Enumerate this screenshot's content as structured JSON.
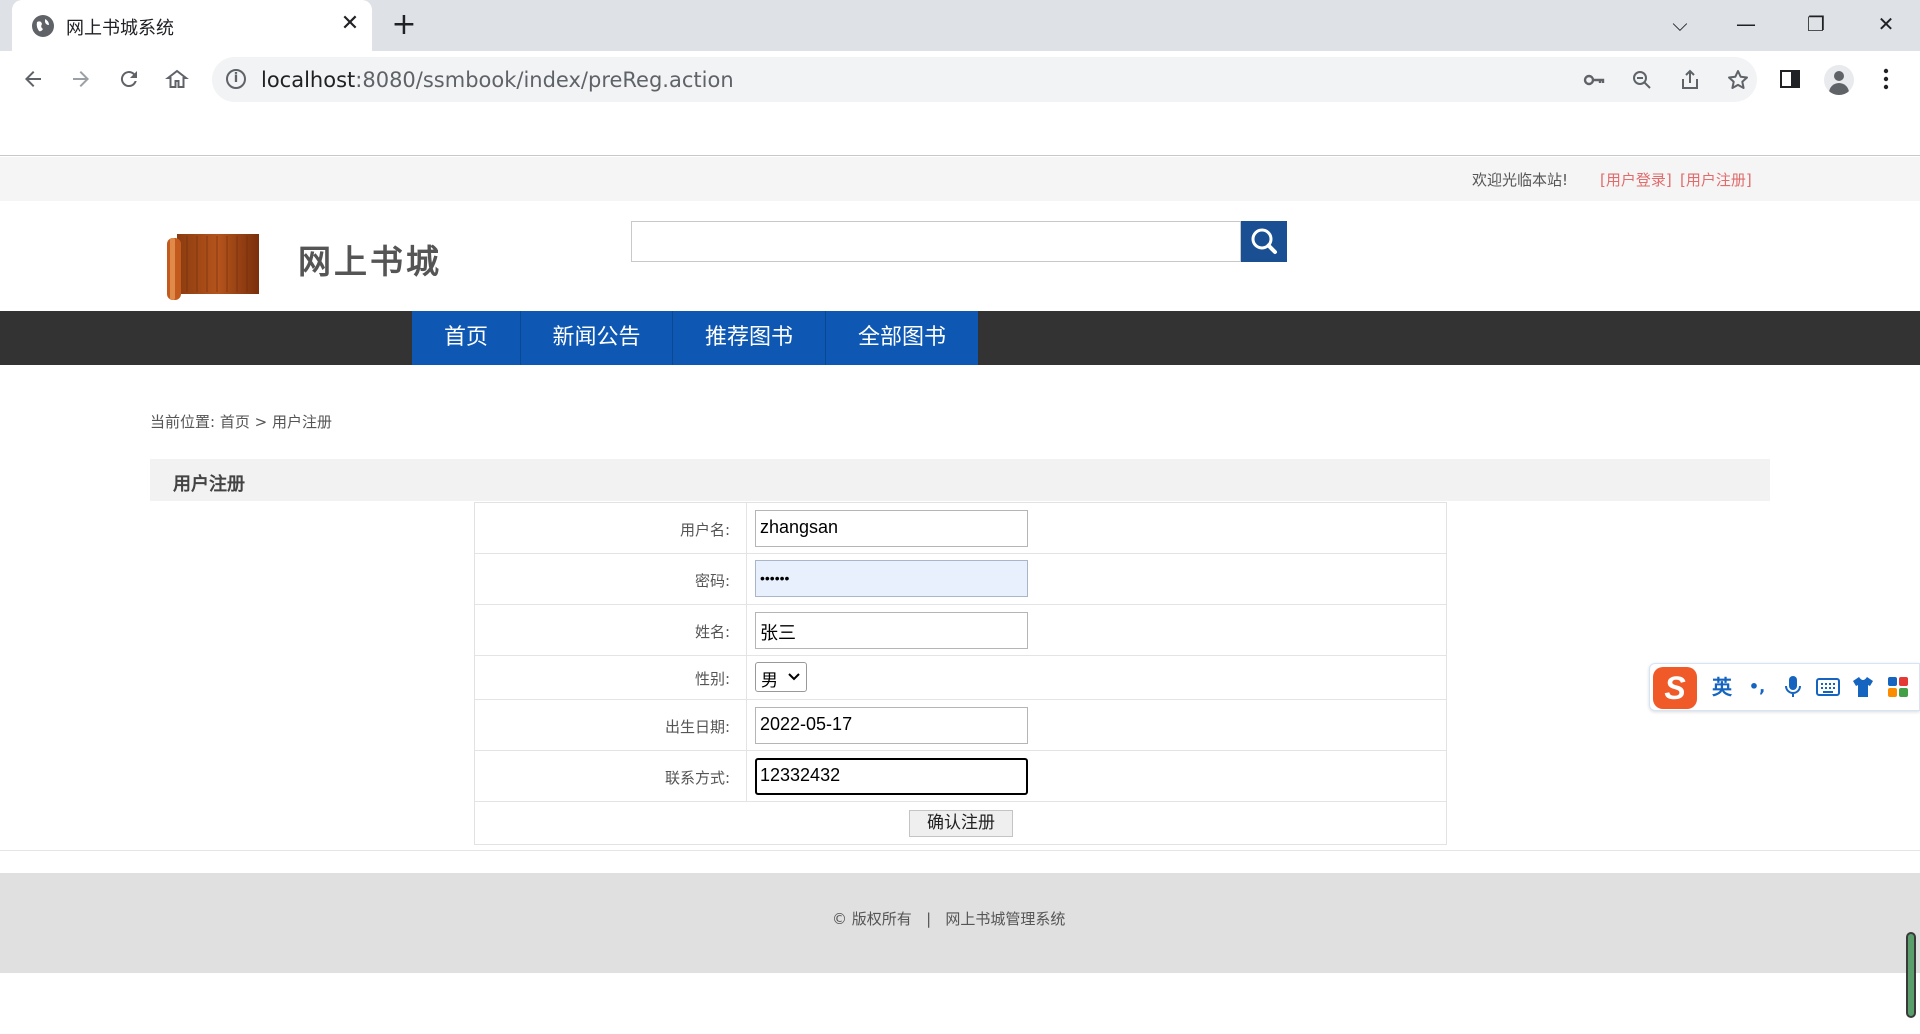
{
  "browser": {
    "tab_title": "网上书城系统",
    "tab_close": "✕",
    "new_tab": "+",
    "url_host": "localhost",
    "url_rest": ":8080/ssmbook/index/preReg.action",
    "window": {
      "chevron": "⌵",
      "minimize": "—",
      "restore": "❐",
      "close": "✕"
    }
  },
  "site": {
    "welcome": "欢迎光临本站!",
    "login_link": "[用户登录]",
    "register_link": "[用户注册]",
    "logo_text": "网上书城",
    "search": {
      "value": ""
    }
  },
  "nav": [
    {
      "label": "首页"
    },
    {
      "label": "新闻公告"
    },
    {
      "label": "推荐图书"
    },
    {
      "label": "全部图书"
    }
  ],
  "breadcrumb": {
    "prefix": "当前位置: ",
    "home": "首页",
    "separator": " > ",
    "current": "用户注册"
  },
  "panel": {
    "title": "用户注册"
  },
  "form": {
    "username_label": "用户名:",
    "username_value": "zhangsan",
    "password_label": "密码:",
    "password_value": "••••••",
    "name_label": "姓名:",
    "name_value": "张三",
    "gender_label": "性别:",
    "gender_value": "男",
    "birth_label": "出生日期:",
    "birth_value": "2022-05-17",
    "contact_label": "联系方式:",
    "contact_value": "12332432",
    "submit_label": "确认注册"
  },
  "footer": {
    "text": "© 版权所有   |   网上书城管理系统"
  },
  "ime": {
    "logo": "S",
    "mode": "英",
    "punct": "•,"
  },
  "colors": {
    "nav_blue": "#0e58b3",
    "nav_bar": "#333333",
    "link_red": "#e06c6c",
    "search_btn": "#1a4f94"
  }
}
